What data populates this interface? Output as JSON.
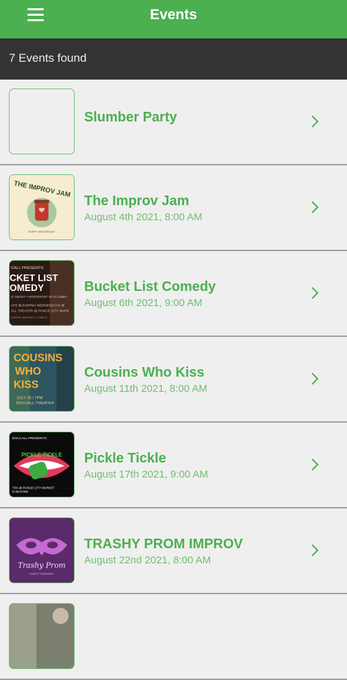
{
  "header": {
    "title": "Events",
    "menu_icon": "hamburger-icon"
  },
  "subheader": {
    "count_text": "7 Events found"
  },
  "colors": {
    "brand_green": "#4caf50",
    "dark_bar": "#333333",
    "background": "#efefef"
  },
  "events": [
    {
      "title": "Slumber Party",
      "date": ""
    },
    {
      "title": "The Improv Jam",
      "date": "August 4th 2021, 8:00 AM",
      "thumb_text": "THE IMPROV JAM"
    },
    {
      "title": "Bucket List Comedy",
      "date": "August 6th 2021, 9:00 AM",
      "thumb_text": "CKET LIST OMEDY"
    },
    {
      "title": "Cousins Who Kiss",
      "date": "August 11th 2021, 8:00 AM",
      "thumb_text": "COUSINS WHO KISS"
    },
    {
      "title": "Pickle Tickle",
      "date": "August 17th 2021, 9:00 AM",
      "thumb_text": "PICKLE TICKLE"
    },
    {
      "title": "TRASHY PROM IMPROV",
      "date": "August 22nd 2021, 8:00 AM",
      "thumb_text": "Trashy Prom"
    },
    {
      "title": "",
      "date": ""
    }
  ]
}
